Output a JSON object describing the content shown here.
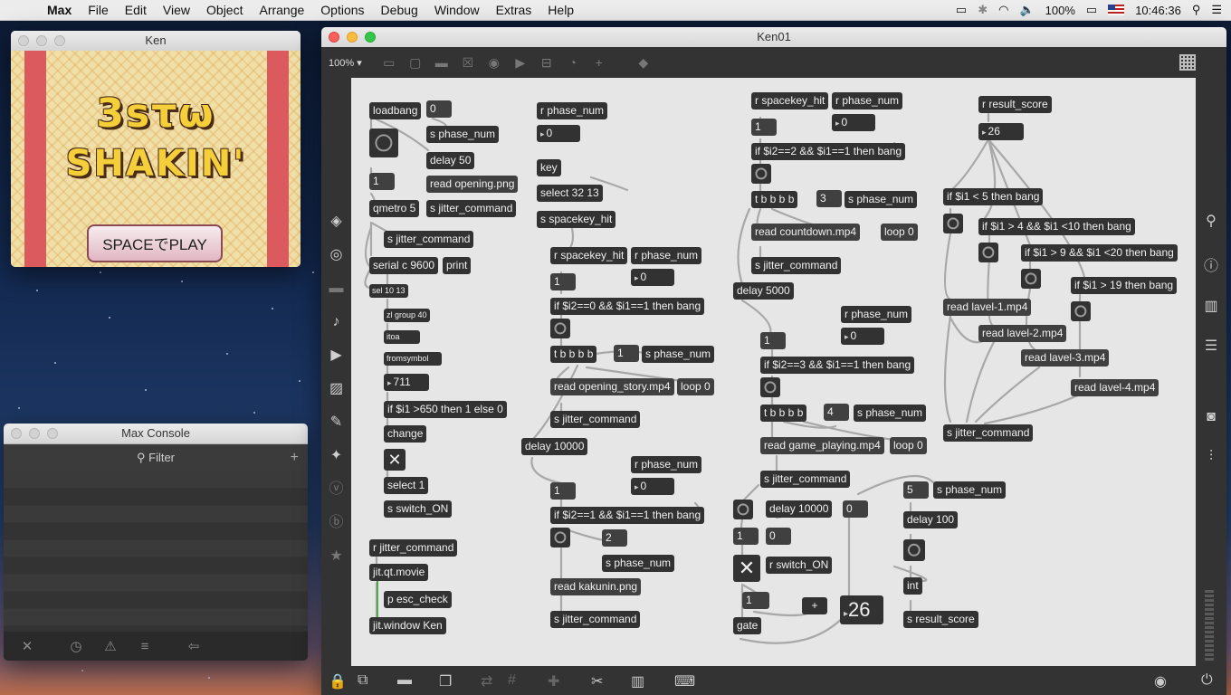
{
  "menubar": {
    "app": "Max",
    "items": [
      "File",
      "Edit",
      "View",
      "Object",
      "Arrange",
      "Options",
      "Debug",
      "Window",
      "Extras",
      "Help"
    ],
    "battery": "100%",
    "time": "10:46:36"
  },
  "ken_window": {
    "title": "Ken",
    "logo_line1": "3sτω",
    "logo_line2": "SHAKIN'",
    "button": "SPACEでPLAY"
  },
  "console": {
    "title": "Max Console",
    "filter_placeholder": "Filter"
  },
  "patcher": {
    "title": "Ken01",
    "zoom": "100%",
    "objects": {
      "loadbang": "loadbang",
      "zero1": "0",
      "s_phase_num1": "s phase_num",
      "delay50": "delay 50",
      "read_opening": "read opening.png",
      "s_jitter1": "s jitter_command",
      "one1": "1",
      "qmetro": "qmetro 5",
      "s_jitter2": "s jitter_command",
      "serial": "serial c 9600",
      "print": "print",
      "sel10": "sel 10 13",
      "zl": "zl group 40",
      "itoa": "itoa",
      "fromsymbol": "fromsymbol",
      "num711": "711",
      "if650": "if $i1 >650 then 1 else 0",
      "change": "change",
      "select1": "select 1",
      "s_switch": "s switch_ON",
      "r_jitter": "r jitter_command",
      "jit_qt": "jit.qt.movie",
      "esc_check": "p esc_check",
      "jit_window": "jit.window Ken",
      "r_phase_a": "r phase_num",
      "num0a": "0",
      "key": "key",
      "select3213": "select 32 13",
      "s_spacekey": "s spacekey_hit",
      "r_spacekey_b": "r spacekey_hit",
      "r_phase_b": "r phase_num",
      "num0b": "0",
      "one_b": "1",
      "if_b": "if $i2==0 && $i1==1 then bang",
      "tbbbb_b": "t b b b b",
      "one_b2": "1",
      "s_phase_b": "s phase_num",
      "read_story": "read opening_story.mp4",
      "loop0_b": "loop 0",
      "s_jitter_b": "s jitter_command",
      "delay10000_b": "delay 10000",
      "r_phase_c": "r phase_num",
      "num0c": "0",
      "one_c": "1",
      "if_c": "if $i2==1 && $i1==1 then bang",
      "two_c": "2",
      "s_phase_c": "s phase_num",
      "read_kakunin": "read kakunin.png",
      "s_jitter_c": "s jitter_command",
      "r_spacekey_d": "r spacekey_hit",
      "r_phase_d": "r phase_num",
      "num0d": "0",
      "one_d": "1",
      "if_d": "if $i2==2 && $i1==1 then bang",
      "tbbbb_d": "t b b b b",
      "three_d": "3",
      "s_phase_d": "s phase_num",
      "read_countdown": "read countdown.mp4",
      "loop0_d": "loop 0",
      "s_jitter_d": "s jitter_command",
      "delay5000": "delay 5000",
      "r_phase_e": "r phase_num",
      "num0e": "0",
      "one_e": "1",
      "if_e": "if $i2==3 && $i1==1 then bang",
      "tbbbb_e": "t b b b b",
      "four_e": "4",
      "s_phase_e": "s phase_num",
      "read_game": "read game_playing.mp4",
      "loop0_e": "loop 0",
      "s_jitter_e": "s jitter_command",
      "delay10000_f": "delay 10000",
      "zero_f": "0",
      "one_f": "1",
      "zero_f2": "0",
      "r_switch": "r switch_ON",
      "one_f2": "1",
      "plus": "+",
      "score_num": "26",
      "gate": "gate",
      "five": "5",
      "s_phase_f": "s phase_num",
      "delay100": "delay 100",
      "int": "int",
      "s_result": "s result_score",
      "r_result": "r result_score",
      "num26": "26",
      "if_lt5": "if $i1 < 5 then bang",
      "if_4_10": "if $i1 > 4 && $i1 <10 then bang",
      "if_9_20": "if $i1 > 9 && $i1 <20 then bang",
      "if_gt19": "if $i1 > 19 then bang",
      "lavel1": "read lavel-1.mp4",
      "lavel2": "read lavel-2.mp4",
      "lavel3": "read lavel-3.mp4",
      "lavel4": "read lavel-4.mp4",
      "s_jitter_g": "s jitter_command"
    }
  }
}
